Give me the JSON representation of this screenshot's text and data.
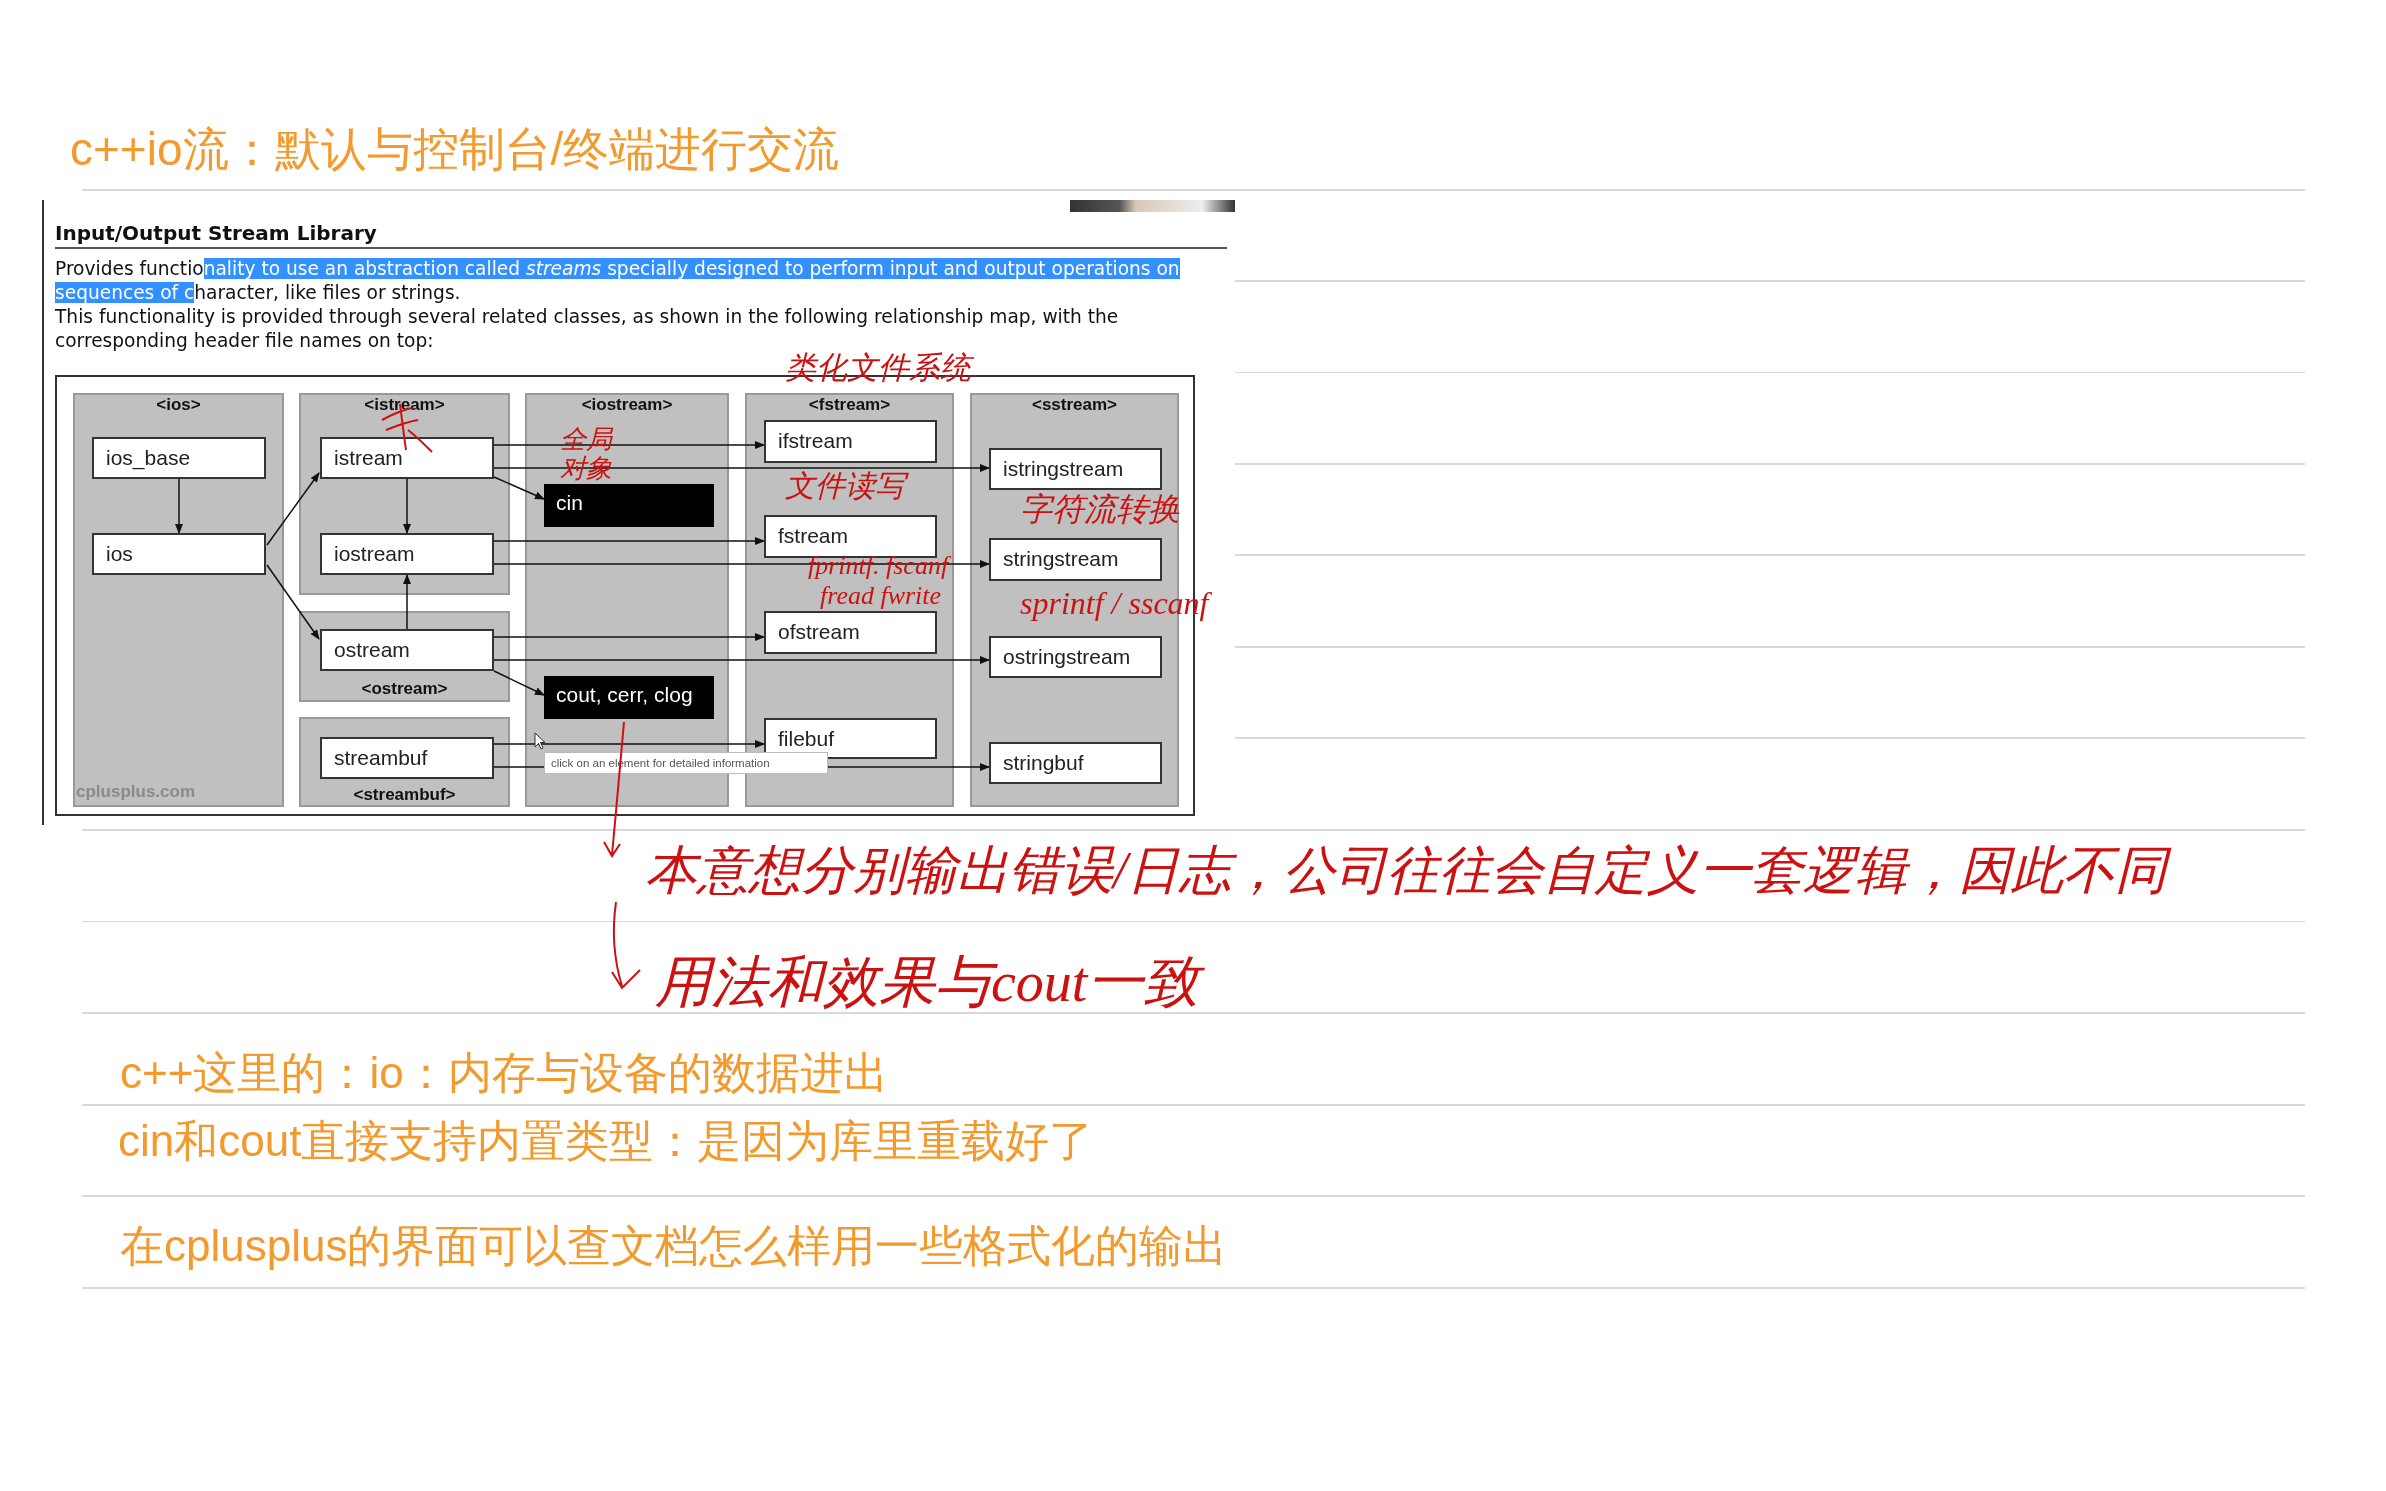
{
  "title": "c++io流：默认与控制台/终端进行交流",
  "screenshot": {
    "heading": "Input/Output Stream Library",
    "intro": {
      "before": "Provides functio",
      "selected": "nality to use an abstraction called *streams* specially designed to perform input and output operations on sequences of c",
      "after": "haracter, like files or strings."
    },
    "paragraph": "This functionality is provided through several related classes, as shown in the following relationship map, with the corresponding header file names on top:",
    "diagram": {
      "headers": [
        "<ios>",
        "<istream>",
        "<iostream>",
        "<fstream>",
        "<sstream>"
      ],
      "footers": [
        "<ostream>",
        "<streambuf>"
      ],
      "nodes": [
        {
          "label": "ios_base",
          "kind": "class"
        },
        {
          "label": "ios",
          "kind": "class"
        },
        {
          "label": "istream",
          "kind": "class"
        },
        {
          "label": "iostream",
          "kind": "class"
        },
        {
          "label": "ostream",
          "kind": "class"
        },
        {
          "label": "streambuf",
          "kind": "class"
        },
        {
          "label": "cin",
          "kind": "object"
        },
        {
          "label": "cout, cerr, clog",
          "kind": "object"
        },
        {
          "label": "ifstream",
          "kind": "class"
        },
        {
          "label": "fstream",
          "kind": "class"
        },
        {
          "label": "ofstream",
          "kind": "class"
        },
        {
          "label": "filebuf",
          "kind": "class"
        },
        {
          "label": "istringstream",
          "kind": "class"
        },
        {
          "label": "stringstream",
          "kind": "class"
        },
        {
          "label": "ostringstream",
          "kind": "class"
        },
        {
          "label": "stringbuf",
          "kind": "class"
        }
      ],
      "site_label": "cplusplus.com",
      "tooltip": "click on an element for detailed information"
    }
  },
  "ink_notes": [
    "类化文件系统",
    "全局对象",
    "文件读写",
    "fprintf. fscanf",
    "fread fwrite",
    "字符流转换",
    "sprintf / sscanf",
    "本意想分别输出错误/日志，公司往往会自定义一套逻辑，因此不同",
    "用法和效果与cout一致"
  ],
  "notes": [
    "c++这里的：io：内存与设备的数据进出",
    "cin和cout直接支持内置类型：是因为库里重载好了",
    "在cplusplus的界面可以查文档怎么样用一些格式化的输出"
  ]
}
